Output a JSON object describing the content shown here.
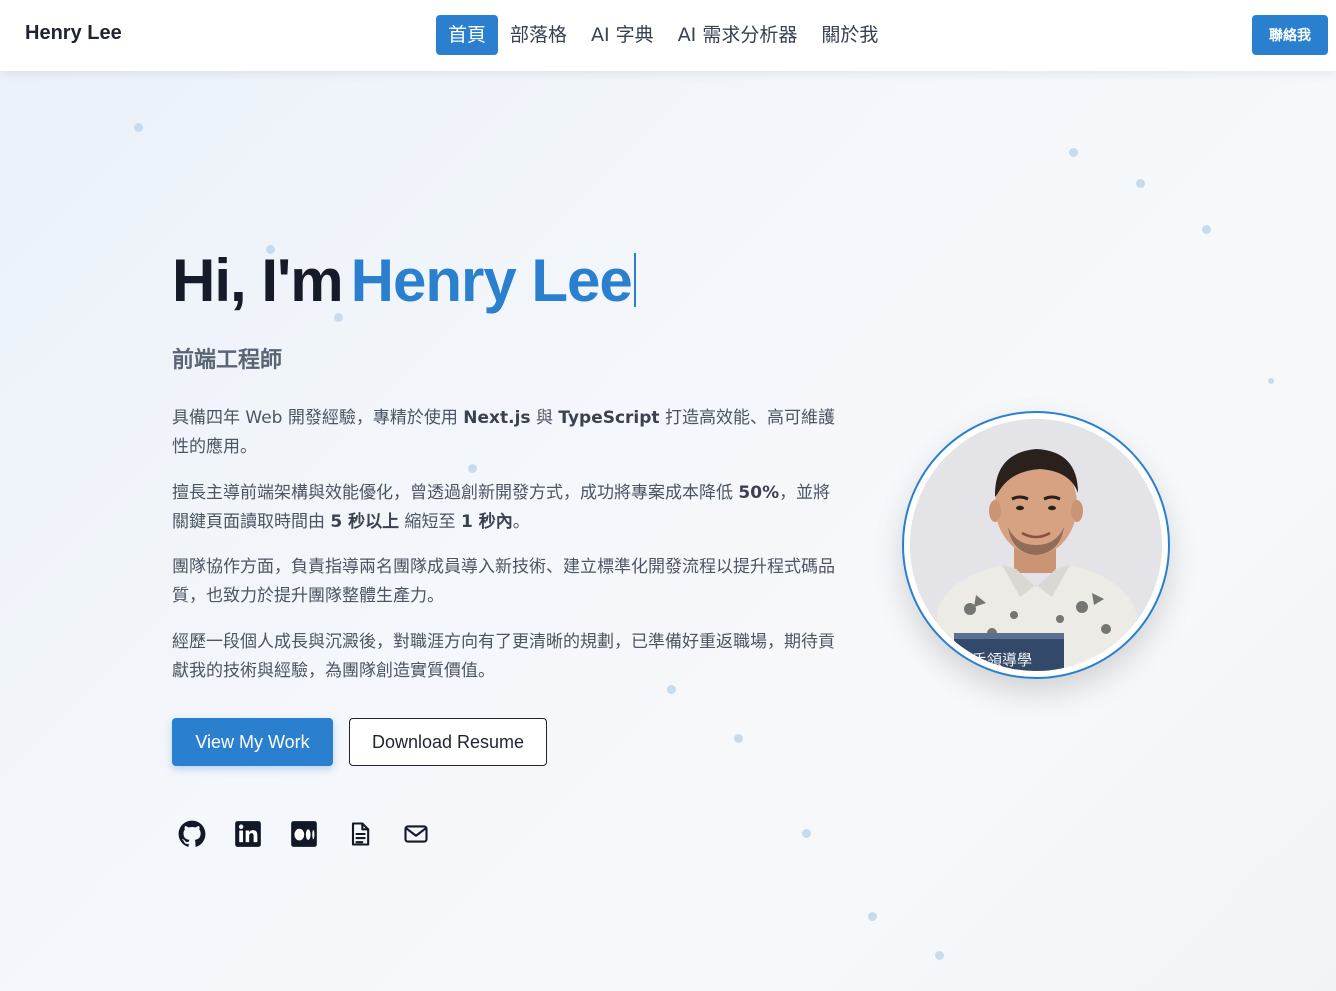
{
  "nav": {
    "brand": "Henry Lee",
    "links": [
      {
        "label": "首頁",
        "active": true
      },
      {
        "label": "部落格",
        "active": false
      },
      {
        "label": "AI 字典",
        "active": false
      },
      {
        "label": "AI 需求分析器",
        "active": false
      },
      {
        "label": "關於我",
        "active": false
      }
    ],
    "contact_label": "聯絡我"
  },
  "hero": {
    "greeting": "Hi, I'm",
    "name": "Henry Lee",
    "role": "前端工程師",
    "p1": {
      "a": "具備四年 Web 開發經驗，專精於使用 ",
      "b1": "Next.js",
      "c": " 與 ",
      "b2": "TypeScript",
      "d": " 打造高效能、高可維護性的應用。"
    },
    "p2": {
      "a": "擅長主導前端架構與效能優化，曾透過創新開發方式，成功將專案成本降低 ",
      "b1": "50%",
      "c": "，並將關鍵頁面讀取時間由 ",
      "b2": "5 秒以上",
      "d": " 縮短至 ",
      "b3": "1 秒內",
      "e": "。"
    },
    "p3": "團隊協作方面，負責指導兩名團隊成員導入新技術、建立標準化開發流程以提升程式碼品質，也致力於提升團隊整體生產力。",
    "p4": "經歷一段個人成長與沉澱後，對職涯方向有了更清晰的規劃，已準備好重返職場，期待貢獻我的技術與經驗，為團隊創造實質價值。",
    "primary_button": "View My Work",
    "secondary_button": "Download Resume",
    "book_text": "手領導學"
  },
  "social_icons": [
    "github-icon",
    "linkedin-icon",
    "medium-icon",
    "resume-document-icon",
    "email-icon"
  ],
  "colors": {
    "accent": "#2a7fcf",
    "heading": "#151b28",
    "body_text": "#4b5563"
  }
}
